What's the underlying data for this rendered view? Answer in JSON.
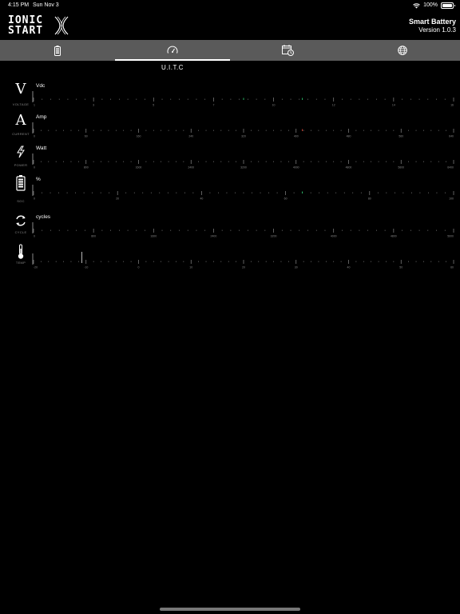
{
  "status_bar": {
    "time": "4:15 PM",
    "date": "Sun Nov 3",
    "battery": "100%"
  },
  "header": {
    "logo_line1": "IONIC",
    "logo_line2": "START",
    "title": "Smart Battery",
    "version": "Version 1.0.3"
  },
  "tabs": [
    {
      "icon": "battery-icon",
      "active": false
    },
    {
      "icon": "speedometer-icon",
      "active": true
    },
    {
      "icon": "calendar-clock-icon",
      "active": false
    },
    {
      "icon": "globe-icon",
      "active": false
    }
  ],
  "section_label": "U.I.T.C",
  "gauges": [
    {
      "key": "voltage",
      "icon": "voltage-icon",
      "glyph": "V",
      "caption": "VOLTAGE",
      "unit": "Vdc",
      "ticks": [
        "1",
        "3",
        "5",
        "7",
        "10",
        "12",
        "14",
        "16"
      ],
      "minor_per_major": 6,
      "value_marks": 2,
      "accent": "#2ecc71"
    },
    {
      "key": "current",
      "icon": "current-icon",
      "glyph": "A",
      "caption": "CURRENT",
      "unit": "Amp",
      "ticks": [
        "0",
        "60",
        "160",
        "240",
        "320",
        "400",
        "480",
        "560",
        "640"
      ],
      "minor_per_major": 6,
      "value_marks": 1,
      "accent": "#e74c3c"
    },
    {
      "key": "power",
      "icon": "power-icon",
      "caption": "POWER",
      "unit": "Watt",
      "ticks": [
        "0",
        "800",
        "1600",
        "2400",
        "3200",
        "4000",
        "4800",
        "5600",
        "6400"
      ],
      "minor_per_major": 6,
      "value_marks": 0
    },
    {
      "key": "soc",
      "icon": "soc-battery-icon",
      "caption": "SOC",
      "unit": "%",
      "ticks": [
        "0",
        "20",
        "40",
        "60",
        "80",
        "100"
      ],
      "minor_per_major": 9,
      "value_marks": 1,
      "accent": "#2ecc71"
    },
    {
      "key": "cycle",
      "icon": "cycle-icon",
      "caption": "CYCLE",
      "unit": "cycles",
      "ticks": [
        "0",
        "800",
        "1600",
        "2400",
        "3200",
        "4000",
        "4800",
        "5600"
      ],
      "minor_per_major": 6,
      "value_marks": 0
    },
    {
      "key": "temp",
      "icon": "thermometer-icon",
      "caption": "TEMP",
      "unit": "",
      "ticks": [
        "-20",
        "-10",
        "0",
        "10",
        "20",
        "30",
        "40",
        "50",
        "60"
      ],
      "minor_per_major": 6,
      "value_marks": 0,
      "marker_fraction": 0.115
    }
  ]
}
